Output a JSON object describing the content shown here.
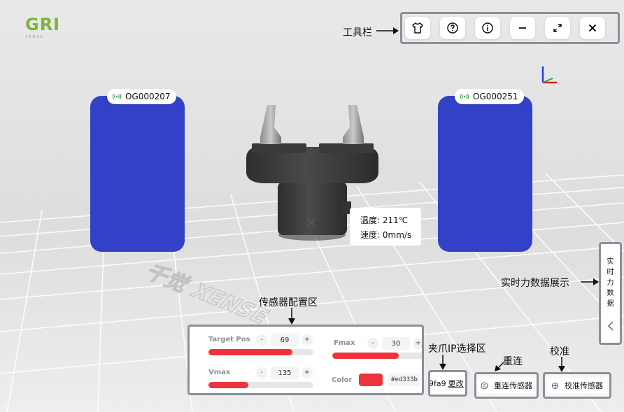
{
  "logo": {
    "main": "GRI",
    "sub": "XENSE"
  },
  "annotations": {
    "toolbar": "工具栏",
    "sensor_config": "传感器配置区",
    "realtime": "实时力数据展示",
    "ip_select": "夹爪IP选择区",
    "reconnect": "重连",
    "calibrate": "校准"
  },
  "toolbar": {
    "buttons": [
      {
        "icon": "shirt-icon"
      },
      {
        "icon": "help-icon"
      },
      {
        "icon": "info-icon"
      },
      {
        "icon": "minimize-icon"
      },
      {
        "icon": "fullscreen-icon"
      },
      {
        "icon": "close-icon"
      }
    ]
  },
  "sensors": [
    {
      "id": "OG000207",
      "color": "#3341c6"
    },
    {
      "id": "OG000251",
      "color": "#3341c6"
    }
  ],
  "gripper_info": {
    "temperature_label": "温度:",
    "temperature_value": "211℃",
    "speed_label": "速度:",
    "speed_value": "0mm/s"
  },
  "watermark": "千觉 XENSE",
  "config": {
    "target_pos": {
      "label": "Target Pos",
      "value": "69",
      "fill": 0.8
    },
    "vmax": {
      "label": "Vmax",
      "value": "135",
      "fill": 0.38
    },
    "fmax": {
      "label": "Fmax",
      "value": "30",
      "fill": 0.68
    },
    "color": {
      "label": "Color",
      "value": "#ed333b"
    },
    "minus": "-",
    "plus": "+"
  },
  "ip": {
    "value": "9fa9",
    "change_label": "更改"
  },
  "actions": {
    "reconnect_label": "重连传感器",
    "calibrate_label": "校准传感器"
  },
  "realtime_tab": {
    "chars": [
      "实",
      "时",
      "力",
      "数",
      "据"
    ],
    "collapse_glyph": "<"
  }
}
